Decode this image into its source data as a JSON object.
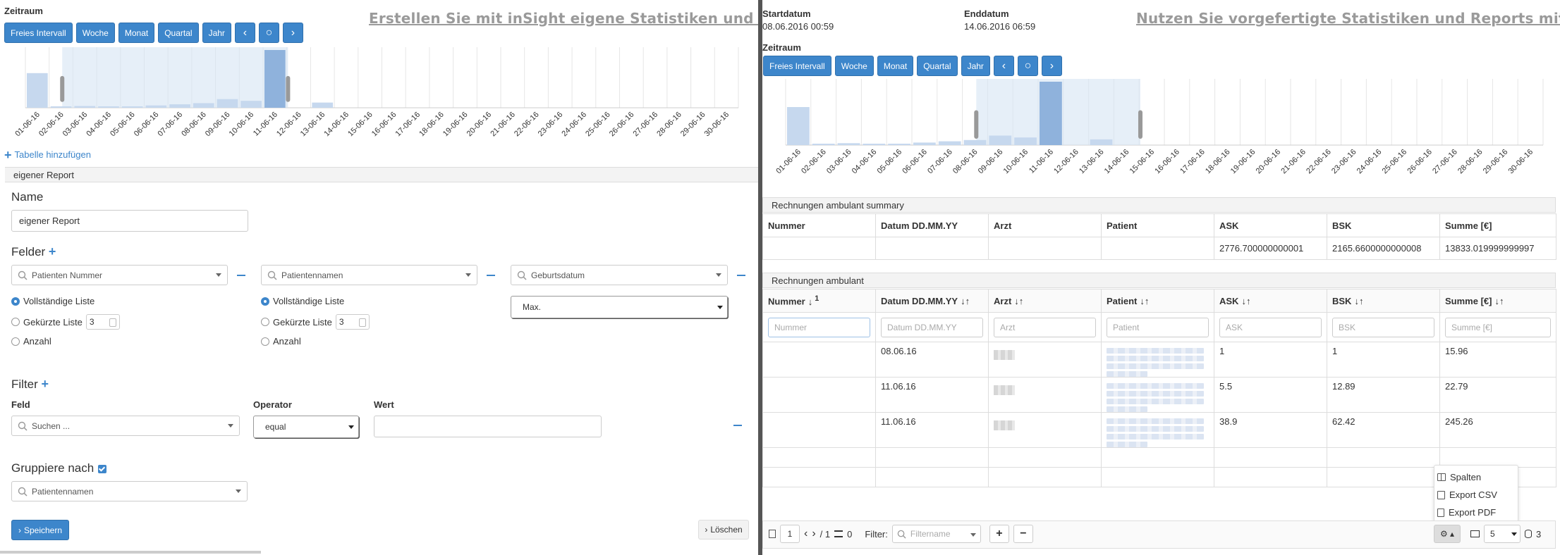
{
  "left": {
    "zeitraum_label": "Zeitraum",
    "headline": "Erstellen Sie mit inSight eigene Statistiken und Reports.",
    "buttons": [
      "Freies Intervall",
      "Woche",
      "Monat",
      "Quartal",
      "Jahr"
    ],
    "nav_prev": "‹",
    "nav_reset": "○",
    "nav_next": "›",
    "chart_data": {
      "type": "bar",
      "categories": [
        "01-06-16",
        "02-06-16",
        "03-06-16",
        "04-06-16",
        "05-06-16",
        "06-06-16",
        "07-06-16",
        "08-06-16",
        "09-06-16",
        "10-06-16",
        "11-06-16",
        "12-06-16",
        "13-06-16",
        "14-06-16",
        "15-06-16",
        "16-06-16",
        "17-06-16",
        "18-06-16",
        "19-06-16",
        "20-06-16",
        "21-06-16",
        "22-06-16",
        "23-06-16",
        "24-06-16",
        "25-06-16",
        "26-06-16",
        "27-06-16",
        "28-06-16",
        "29-06-16",
        "30-06-16"
      ],
      "values": [
        60,
        2,
        3,
        1,
        1,
        4,
        6,
        8,
        15,
        12,
        100,
        0,
        9,
        0,
        0,
        0,
        0,
        0,
        0,
        0,
        0,
        0,
        0,
        0,
        0,
        0,
        0,
        0,
        0,
        0
      ],
      "selected_range": [
        "02-06-16",
        "11-06-16"
      ],
      "highlight": "11-06-16",
      "grid": true
    },
    "add_table": "Tabelle hinzufügen",
    "section_title": "eigener Report",
    "name_label": "Name",
    "name_value": "eigener Report",
    "felder_label": "Felder",
    "fields": [
      {
        "select": "Patienten Nummer",
        "mode": "full"
      },
      {
        "select": "Patientennamen",
        "mode": "full"
      },
      {
        "select": "Geburtsdatum",
        "agg": "Max."
      }
    ],
    "opt_full": "Vollständige Liste",
    "opt_short": "Gekürzte Liste",
    "opt_count": "Anzahl",
    "short_value": "3",
    "filter_label": "Filter",
    "col_feld": "Feld",
    "col_operator": "Operator",
    "col_wert": "Wert",
    "search_placeholder": "Suchen ...",
    "operator_value": "equal",
    "gruppiere_label": "Gruppiere nach",
    "group_value": "Patientennamen",
    "save_label": "Speichern",
    "delete_label": "Löschen"
  },
  "right": {
    "start_label": "Startdatum",
    "start_value": "08.06.2016 00:59",
    "end_label": "Enddatum",
    "end_value": "14.06.2016 06:59",
    "headline": "Nutzen Sie vorgefertigte Statistiken und Reports mit inSigth.",
    "zeitraum_label": "Zeitraum",
    "buttons": [
      "Freies Intervall",
      "Woche",
      "Monat",
      "Quartal",
      "Jahr"
    ],
    "nav_prev": "‹",
    "nav_reset": "○",
    "nav_next": "›",
    "chart_data": {
      "type": "bar",
      "categories": [
        "01-06-16",
        "02-06-16",
        "03-06-16",
        "04-06-16",
        "05-06-16",
        "06-06-16",
        "07-06-16",
        "08-06-16",
        "09-06-16",
        "10-06-16",
        "11-06-16",
        "12-06-16",
        "13-06-16",
        "14-06-16",
        "15-06-16",
        "16-06-16",
        "17-06-16",
        "18-06-16",
        "19-06-16",
        "20-06-16",
        "21-06-16",
        "22-06-16",
        "23-06-16",
        "24-06-16",
        "25-06-16",
        "26-06-16",
        "27-06-16",
        "28-06-16",
        "29-06-16",
        "30-06-16"
      ],
      "values": [
        60,
        2,
        3,
        1,
        1,
        4,
        6,
        8,
        15,
        12,
        100,
        0,
        9,
        0,
        0,
        0,
        0,
        0,
        0,
        0,
        0,
        0,
        0,
        0,
        0,
        0,
        0,
        0,
        0,
        0
      ],
      "selected_range": [
        "08-06-16",
        "14-06-16"
      ],
      "highlight": "11-06-16",
      "grid": true
    },
    "summary_title": "Rechnungen ambulant summary",
    "summary_headers": [
      "Nummer",
      "Datum DD.MM.YY",
      "Arzt",
      "Patient",
      "ASK",
      "BSK",
      "Summe [€]"
    ],
    "summary_values": [
      "",
      "",
      "",
      "",
      "2776.700000000001",
      "2165.6600000000008",
      "13833.019999999997"
    ],
    "table_title": "Rechnungen ambulant",
    "table_headers": [
      "Nummer",
      "Datum DD.MM.YY",
      "Arzt",
      "Patient",
      "ASK",
      "BSK",
      "Summe [€]"
    ],
    "sort_index": "1",
    "filter_placeholders": [
      "Nummer",
      "Datum DD.MM.YY",
      "Arzt",
      "Patient",
      "ASK",
      "BSK",
      "Summe [€]"
    ],
    "rows": [
      {
        "datum": "08.06.16",
        "ask": "1",
        "bsk": "1",
        "summe": "15.96"
      },
      {
        "datum": "11.06.16",
        "ask": "5.5",
        "bsk": "12.89",
        "summe": "22.79"
      },
      {
        "datum": "11.06.16",
        "ask": "38.9",
        "bsk": "62.42",
        "summe": "245.26"
      }
    ],
    "menu": [
      "Spalten",
      "Export CSV",
      "Export PDF"
    ],
    "pager": {
      "page": "1",
      "of": "/ 1",
      "count": "0",
      "filter_label": "Filter:",
      "filter_placeholder": "Filtername",
      "page_size": "5",
      "total": "3"
    }
  }
}
